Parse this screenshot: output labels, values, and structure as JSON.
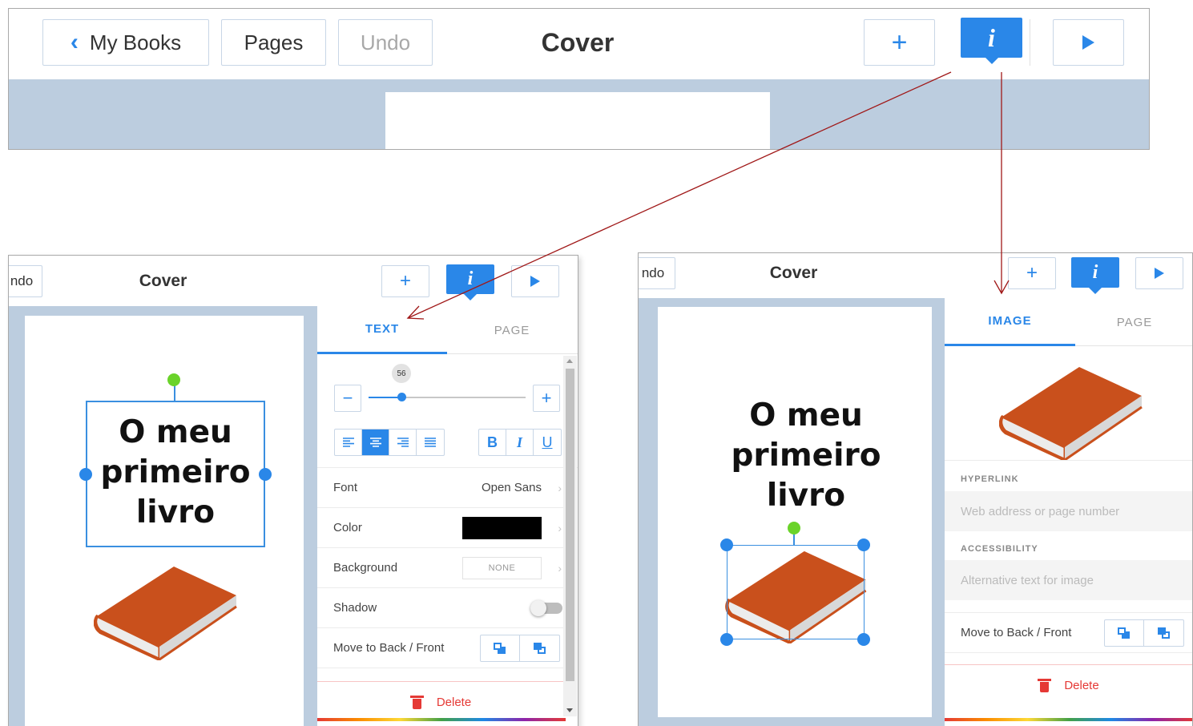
{
  "top": {
    "back_label": "My Books",
    "pages_label": "Pages",
    "undo_label": "Undo",
    "title": "Cover",
    "add_label": "+",
    "info_label": "i"
  },
  "left": {
    "undo_partial": "ndo",
    "title": "Cover",
    "add_label": "+",
    "info_label": "i",
    "cover_lines": [
      "O meu",
      "primeiro",
      "livro"
    ],
    "tabs": {
      "text": "TEXT",
      "page": "PAGE"
    },
    "font_size_value": "56",
    "minus_label": "−",
    "plus_label": "+",
    "align_icons": [
      "align-left-icon",
      "align-center-icon",
      "align-right-icon",
      "align-justify-icon"
    ],
    "style_buttons": {
      "bold": "B",
      "italic": "I",
      "underline": "U"
    },
    "rows": {
      "font_label": "Font",
      "font_value": "Open Sans",
      "color_label": "Color",
      "color_value": "#000000",
      "background_label": "Background",
      "background_value": "NONE",
      "shadow_label": "Shadow",
      "move_label": "Move to Back / Front"
    },
    "delete_label": "Delete"
  },
  "right": {
    "undo_partial": "ndo",
    "title": "Cover",
    "add_label": "+",
    "info_label": "i",
    "cover_lines": [
      "O meu",
      "primeiro",
      "livro"
    ],
    "tabs": {
      "image": "IMAGE",
      "page": "PAGE"
    },
    "hyperlink_title": "HYPERLINK",
    "hyperlink_placeholder": "Web address or page number",
    "accessibility_title": "ACCESSIBILITY",
    "accessibility_placeholder": "Alternative text for image",
    "move_label": "Move to Back / Front",
    "delete_label": "Delete"
  },
  "colors": {
    "accent": "#2a87e8",
    "canvas_bg": "#bccddf",
    "delete": "#e53935",
    "rotate_handle": "#6ad32a",
    "book_cover": "#c9501c",
    "arrow": "#a01818"
  },
  "icons": [
    "chevron-left-icon",
    "plus-icon",
    "info-icon",
    "play-icon",
    "book-icon",
    "trash-icon",
    "send-to-back-icon",
    "bring-to-front-icon",
    "chevron-right-icon"
  ]
}
